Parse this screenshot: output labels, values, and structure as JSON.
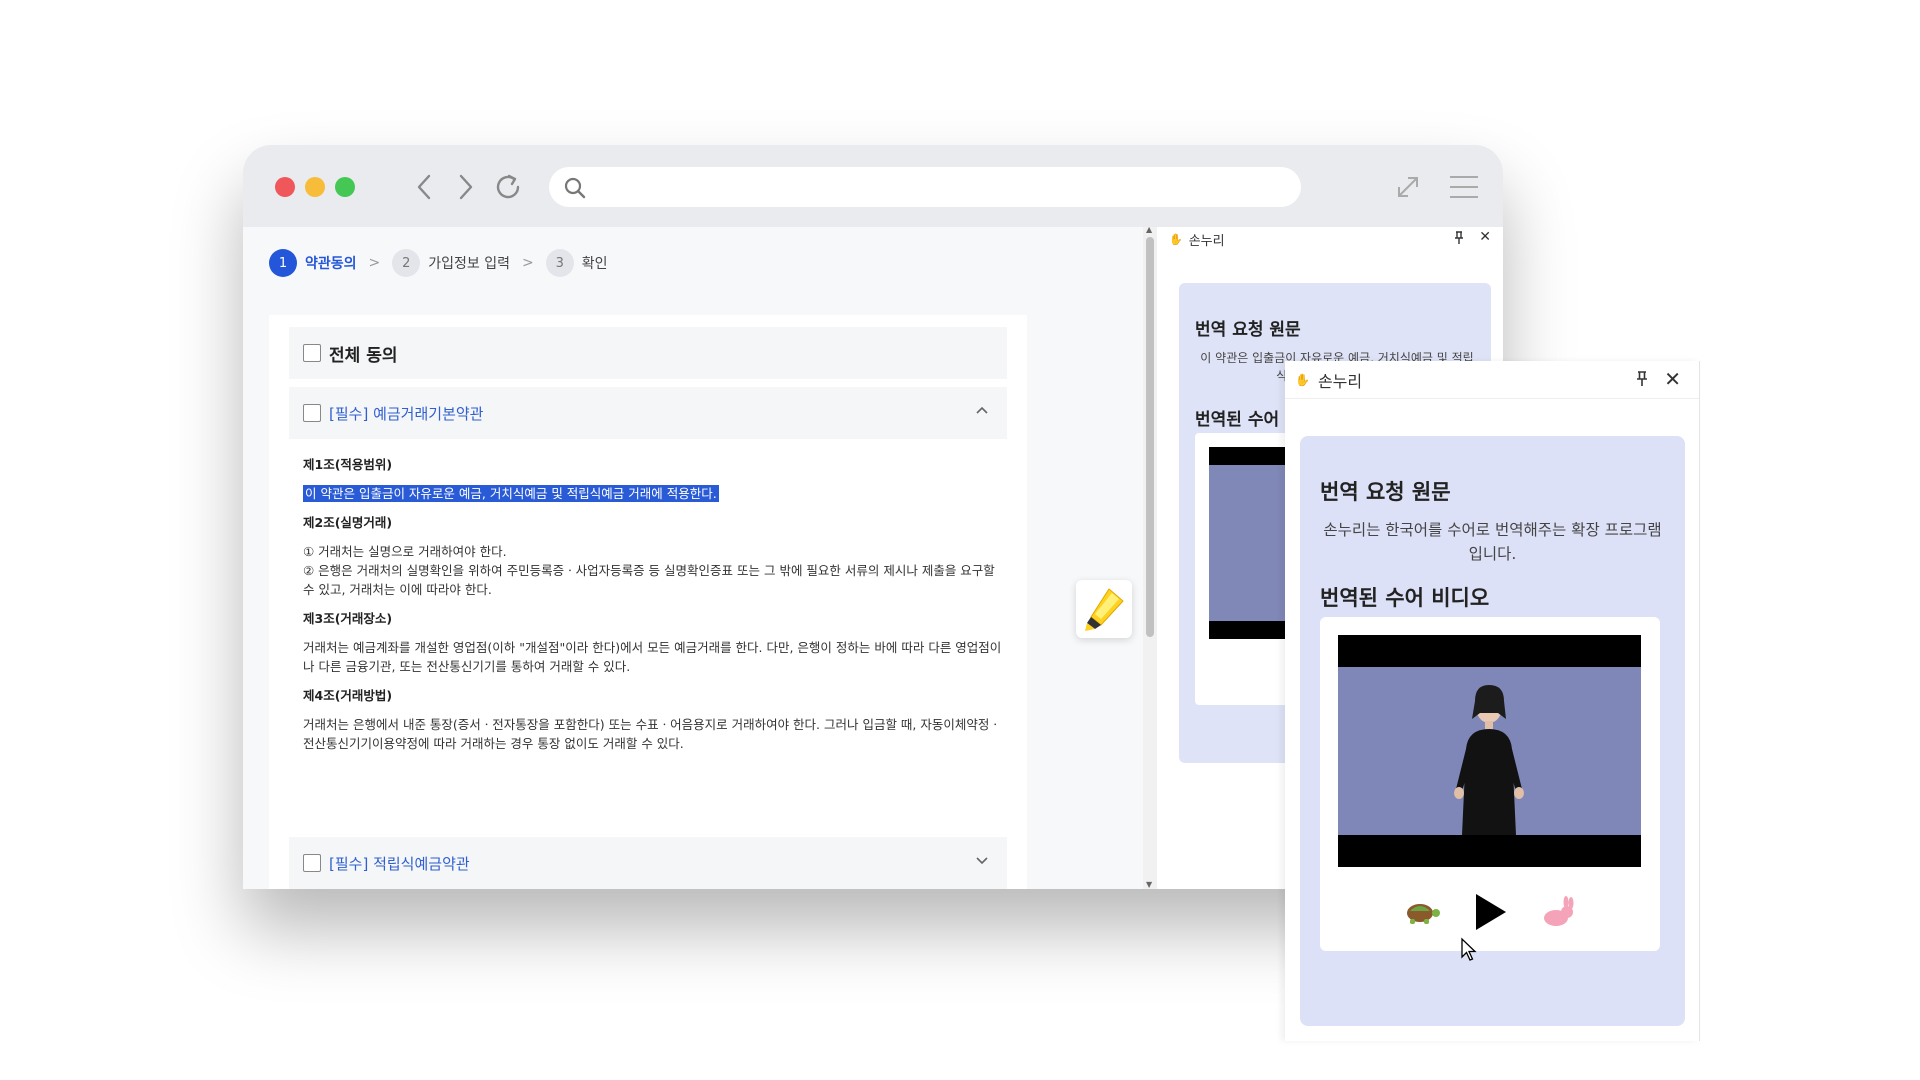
{
  "steps": [
    {
      "num": "1",
      "label": "약관동의"
    },
    {
      "num": "2",
      "label": "가입정보 입력"
    },
    {
      "num": "3",
      "label": "확인"
    }
  ],
  "step_separator": ">",
  "all_agree_label": "전체 동의",
  "terms": [
    {
      "label": "[필수] 예금거래기본약관",
      "expanded": true
    },
    {
      "label": "[필수] 적립식예금약관",
      "expanded": false
    }
  ],
  "articles": [
    {
      "title": "제1조(적용범위)",
      "lines": [
        "이 약관은 입출금이 자유로운 예금, 거치식예금 및 적립식예금 거래에 적용한다."
      ],
      "highlighted": true
    },
    {
      "title": "제2조(실명거래)",
      "lines": [
        "① 거래처는 실명으로 거래하여야 한다.",
        "② 은행은 거래처의 실명확인을 위하여 주민등록증ㆍ사업자등록증 등 실명확인증표 또는 그 밖에 필요한 서류의 제시나 제출을 요구할 수 있고, 거래처는 이에 따라야 한다."
      ]
    },
    {
      "title": "제3조(거래장소)",
      "lines": [
        "거래처는 예금계좌를 개설한 영업점(이하 \"개설점\"이라 한다)에서 모든 예금거래를 한다. 다만, 은행이 정하는 바에 따라 다른 영업점이나 다른 금융기관, 또는 전산통신기기를 통하여 거래할 수 있다."
      ]
    },
    {
      "title": "제4조(거래방법)",
      "lines": [
        "거래처는 은행에서 내준 통장(증서ㆍ전자통장을 포함한다) 또는 수표ㆍ어음용지로 거래하여야 한다. 그러나 입금할 때, 자동이체약정ㆍ전산통신기기이용약정에 따라 거래하는 경우 통장 없이도 거래할 수 있다."
      ]
    }
  ],
  "extension": {
    "name": "손누리",
    "source_title": "번역 요청 원문",
    "source_text": "손누리는 한국어를 수어로 번역해주는 확장 프로그램입니다.",
    "back_source_text": "이 약관은 입출금이 자유로운 예금, 거치식예금 및 적립식예금 거래에 적용한다.",
    "video_title": "번역된 수어 비디오",
    "back_video_title": "번역된 수어"
  },
  "icons": {
    "back": "chevron-left-icon",
    "forward": "chevron-right-icon",
    "reload": "reload-icon",
    "search": "search-icon",
    "expand": "expand-icon",
    "menu": "hamburger-icon",
    "highlighter": "highlighter-icon",
    "slow": "turtle-icon",
    "play": "play-icon",
    "fast": "rabbit-icon"
  },
  "colors": {
    "accent": "#2356d8",
    "card": "#dde1f7",
    "video": "#7f87b9"
  }
}
